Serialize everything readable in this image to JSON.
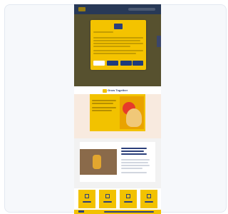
{
  "promo": {
    "tagline": "Grow Together"
  }
}
